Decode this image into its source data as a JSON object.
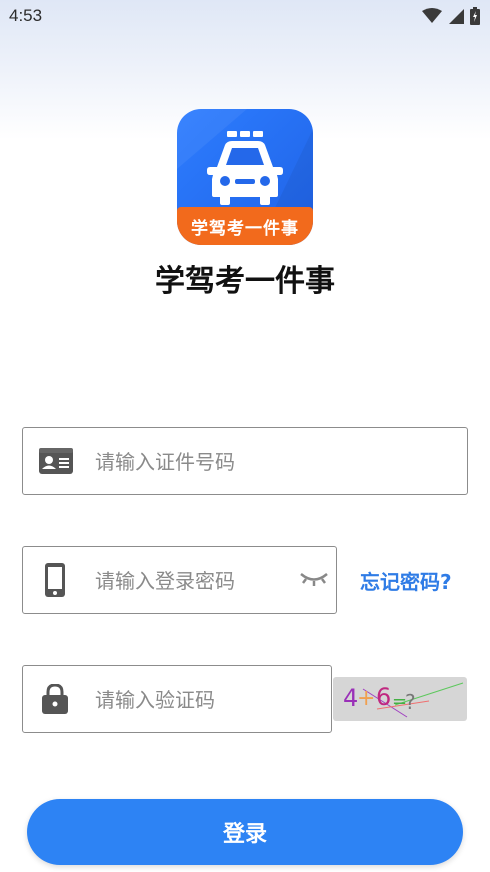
{
  "status": {
    "time": "4:53"
  },
  "app": {
    "logo_text": "学驾考一件事",
    "title": "学驾考一件事"
  },
  "form": {
    "id_placeholder": "请输入证件号码",
    "password_placeholder": "请输入登录密码",
    "captcha_placeholder": "请输入验证码",
    "forgot_label": "忘记密码?",
    "captcha": {
      "d1": "4",
      "op": "+",
      "d2": "6",
      "eq": "=",
      "q": "?"
    },
    "login_label": "登录"
  },
  "colors": {
    "accent": "#2d83f4",
    "link": "#2f7ce6",
    "logo_band": "#f26a1c"
  }
}
